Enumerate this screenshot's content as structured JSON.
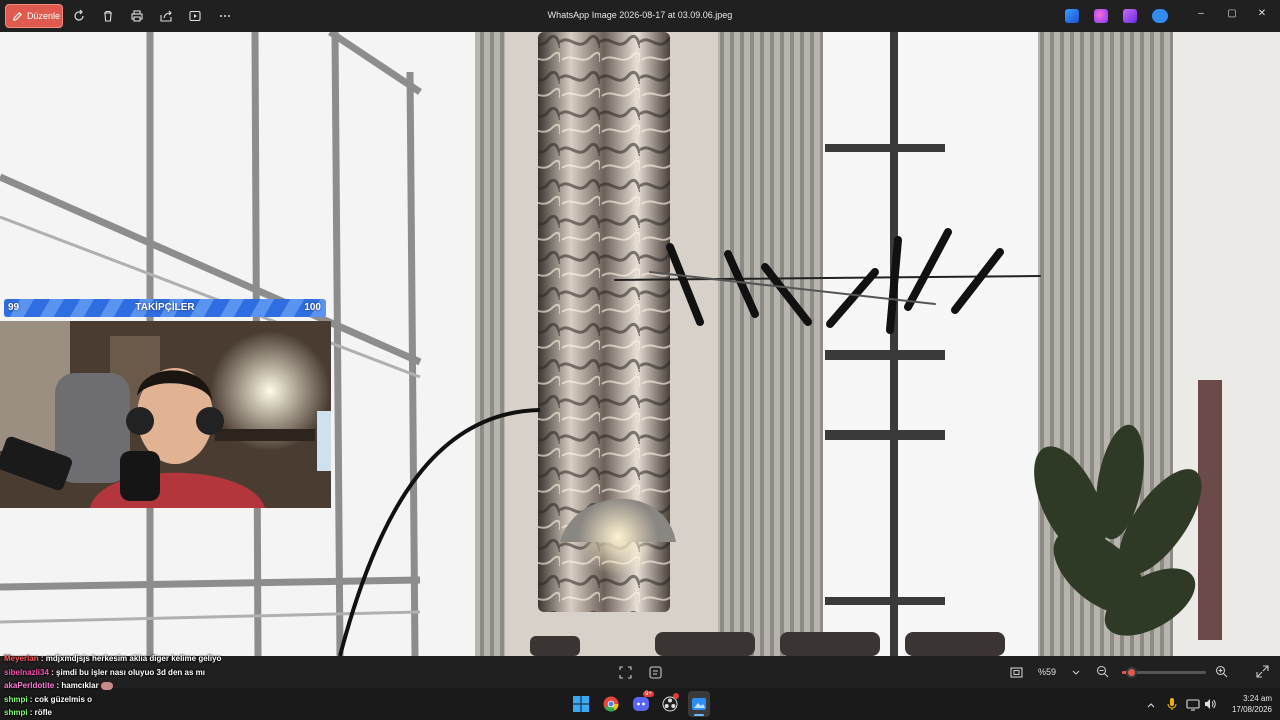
{
  "titlebar": {
    "edit_label": "Düzenle",
    "title": "WhatsApp Image 2026-08-17 at 03.09.06.jpeg",
    "controls": [
      "–",
      "▢",
      "✕"
    ]
  },
  "follower_goal": {
    "left": "99",
    "label": "TAKİPÇİLER",
    "right": "100"
  },
  "chat": [
    {
      "user": "Meyerlan",
      "text": " : mdjxmdjsjs herkesim aklıa diger kelime geliyo",
      "color": "#ff5a5a"
    },
    {
      "user": "sibelnazli34",
      "text": " : şimdi bu işler nası oluyuo 3d den as mı",
      "color": "#ff4fb3"
    },
    {
      "user": "akaPerldotite",
      "text": " : hamcıklar",
      "color": "#ff7ad9"
    },
    {
      "user": "shmpi",
      "text": " : cok güzelmis o",
      "color": "#7cff6a"
    },
    {
      "user": "shmpi",
      "text": " : röfle",
      "color": "#7cff6a"
    }
  ],
  "viewer": {
    "zoom": "%59"
  },
  "taskbar": {
    "time": "3:24 am",
    "date": "17/08/2026",
    "discord_badge": "9+"
  },
  "colors": {
    "edit_button": "#e05a4f",
    "follower_bar": "#2f6ee0",
    "titlebar_bg": "#202020"
  }
}
